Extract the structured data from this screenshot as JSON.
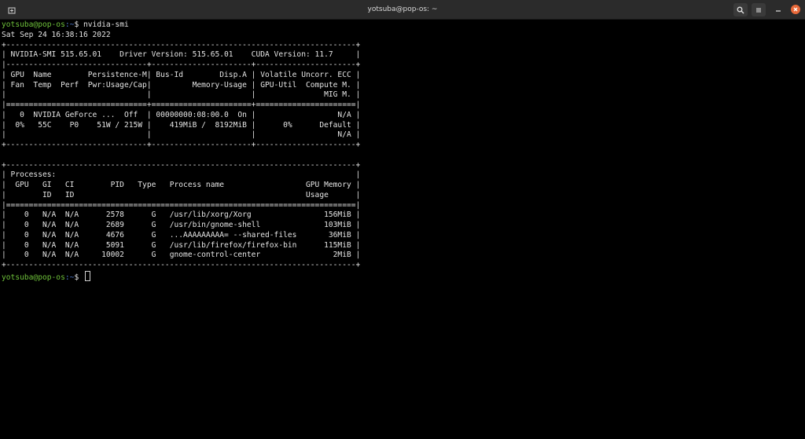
{
  "window": {
    "title": "yotsuba@pop-os: ~",
    "icons": [
      "new-tab-icon",
      "search-icon",
      "menu-icon",
      "minimize-icon",
      "close-icon"
    ]
  },
  "prompt": {
    "user_host": "yotsuba@pop-os",
    "path": ":~",
    "symbol": "$ "
  },
  "command": "nvidia-smi",
  "output_lines": [
    "Sat Sep 24 16:38:16 2022",
    "+-----------------------------------------------------------------------------+",
    "| NVIDIA-SMI 515.65.01    Driver Version: 515.65.01    CUDA Version: 11.7     |",
    "|-------------------------------+----------------------+----------------------+",
    "| GPU  Name        Persistence-M| Bus-Id        Disp.A | Volatile Uncorr. ECC |",
    "| Fan  Temp  Perf  Pwr:Usage/Cap|         Memory-Usage | GPU-Util  Compute M. |",
    "|                               |                      |               MIG M. |",
    "|===============================+======================+======================|",
    "|   0  NVIDIA GeForce ...  Off  | 00000000:08:00.0  On |                  N/A |",
    "|  0%   55C    P0    51W / 215W |    419MiB /  8192MiB |      0%      Default |",
    "|                               |                      |                  N/A |",
    "+-------------------------------+----------------------+----------------------+",
    "",
    "+-----------------------------------------------------------------------------+",
    "| Processes:                                                                  |",
    "|  GPU   GI   CI        PID   Type   Process name                  GPU Memory |",
    "|        ID   ID                                                   Usage      |",
    "|=============================================================================|",
    "|    0   N/A  N/A      2578      G   /usr/lib/xorg/Xorg                156MiB |",
    "|    0   N/A  N/A      2689      G   /usr/bin/gnome-shell              103MiB |",
    "|    0   N/A  N/A      4676      G   ...AAAAAAAAA= --shared-files       36MiB |",
    "|    0   N/A  N/A      5091      G   /usr/lib/firefox/firefox-bin      115MiB |",
    "|    0   N/A  N/A     10002      G   gnome-control-center                2MiB |",
    "+-----------------------------------------------------------------------------+"
  ],
  "colors": {
    "background": "#000000",
    "text": "#e4e4e4",
    "prompt_user": "#6ec13a",
    "prompt_path": "#4f7cd0",
    "titlebar": "#2b2b2b",
    "close_button": "#e8693a"
  }
}
